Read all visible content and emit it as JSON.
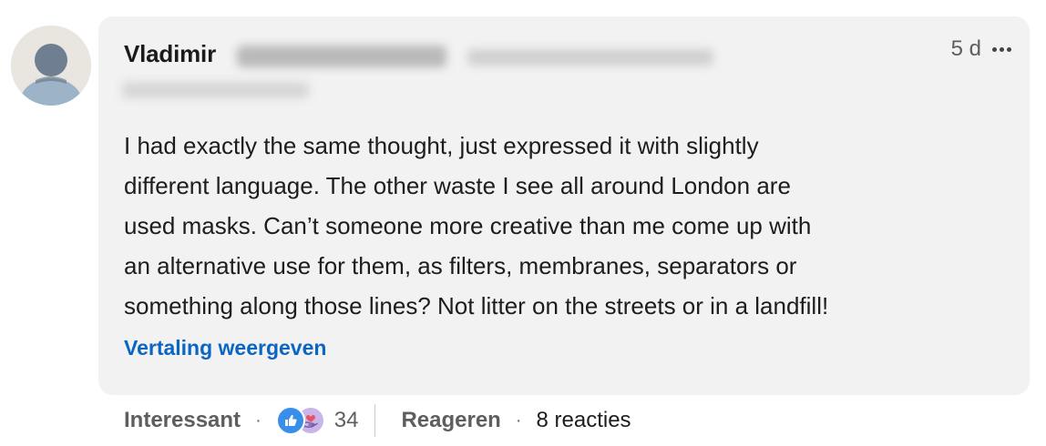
{
  "author": {
    "name": "Vladimir"
  },
  "comment": {
    "timestamp": "5 d",
    "text": "I had exactly the same thought, just expressed it with slightly\ndifferent language. The other waste I see all around London are\nused masks. Can’t someone more creative than me come up with\nan alternative use for them, as filters, membranes, separators or\nsomething along those lines? Not litter on the streets or in a landfill!",
    "translate_label": "Vertaling weergeven"
  },
  "actions": {
    "reaction_label": "Interessant",
    "separator": "·",
    "reaction_count": "34",
    "reply_label": "Reageren",
    "replies_label": "8 reacties"
  },
  "icons": {
    "avatar": "person-placeholder-icon",
    "more": "ellipsis-icon",
    "reaction_1": "like-thumb-icon",
    "reaction_2": "support-heart-hand-icon"
  },
  "colors": {
    "bubble": "#f2f2f2",
    "link": "#0a66c2",
    "like": "#378fe9",
    "support": "#c9b5e8"
  }
}
